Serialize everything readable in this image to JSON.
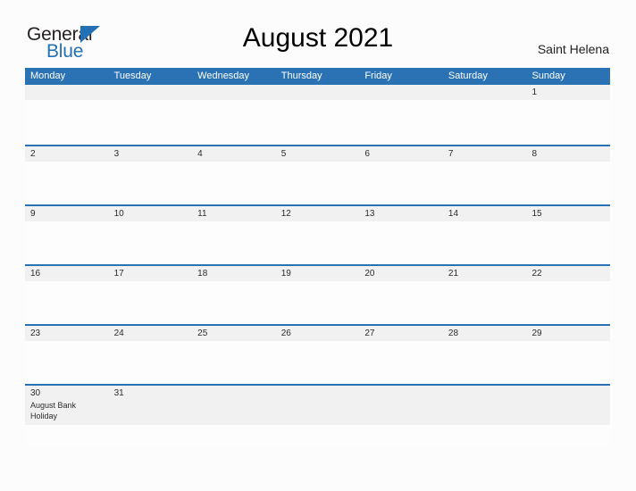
{
  "brand": {
    "name_part1": "General",
    "name_part2": "Blue",
    "triangle_icon": "triangle-icon",
    "accent_color": "#2470b4"
  },
  "header": {
    "title": "August 2021",
    "region": "Saint Helena"
  },
  "calendar": {
    "month": "August",
    "year": "2021",
    "header_color": "#2b72b4",
    "band_color": "#f1f1f1",
    "weekdays": [
      "Monday",
      "Tuesday",
      "Wednesday",
      "Thursday",
      "Friday",
      "Saturday",
      "Sunday"
    ],
    "weeks": [
      {
        "tall": false,
        "days": [
          {
            "number": "",
            "event": ""
          },
          {
            "number": "",
            "event": ""
          },
          {
            "number": "",
            "event": ""
          },
          {
            "number": "",
            "event": ""
          },
          {
            "number": "",
            "event": ""
          },
          {
            "number": "",
            "event": ""
          },
          {
            "number": "1",
            "event": ""
          }
        ]
      },
      {
        "tall": false,
        "days": [
          {
            "number": "2",
            "event": ""
          },
          {
            "number": "3",
            "event": ""
          },
          {
            "number": "4",
            "event": ""
          },
          {
            "number": "5",
            "event": ""
          },
          {
            "number": "6",
            "event": ""
          },
          {
            "number": "7",
            "event": ""
          },
          {
            "number": "8",
            "event": ""
          }
        ]
      },
      {
        "tall": false,
        "days": [
          {
            "number": "9",
            "event": ""
          },
          {
            "number": "10",
            "event": ""
          },
          {
            "number": "11",
            "event": ""
          },
          {
            "number": "12",
            "event": ""
          },
          {
            "number": "13",
            "event": ""
          },
          {
            "number": "14",
            "event": ""
          },
          {
            "number": "15",
            "event": ""
          }
        ]
      },
      {
        "tall": false,
        "days": [
          {
            "number": "16",
            "event": ""
          },
          {
            "number": "17",
            "event": ""
          },
          {
            "number": "18",
            "event": ""
          },
          {
            "number": "19",
            "event": ""
          },
          {
            "number": "20",
            "event": ""
          },
          {
            "number": "21",
            "event": ""
          },
          {
            "number": "22",
            "event": ""
          }
        ]
      },
      {
        "tall": false,
        "days": [
          {
            "number": "23",
            "event": ""
          },
          {
            "number": "24",
            "event": ""
          },
          {
            "number": "25",
            "event": ""
          },
          {
            "number": "26",
            "event": ""
          },
          {
            "number": "27",
            "event": ""
          },
          {
            "number": "28",
            "event": ""
          },
          {
            "number": "29",
            "event": ""
          }
        ]
      },
      {
        "tall": true,
        "days": [
          {
            "number": "30",
            "event": "August Bank Holiday"
          },
          {
            "number": "31",
            "event": ""
          },
          {
            "number": "",
            "event": ""
          },
          {
            "number": "",
            "event": ""
          },
          {
            "number": "",
            "event": ""
          },
          {
            "number": "",
            "event": ""
          },
          {
            "number": "",
            "event": ""
          }
        ]
      }
    ]
  }
}
